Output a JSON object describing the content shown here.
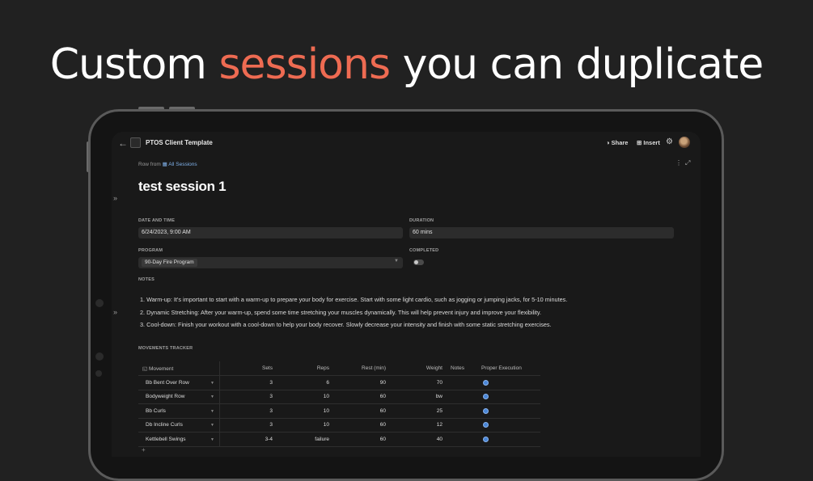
{
  "headline": {
    "before": "Custom",
    "accent": "sessions",
    "after": "you can duplicate"
  },
  "colors": {
    "accent": "#ee6b52",
    "background": "#212121",
    "link": "#7fb0e8"
  },
  "topbar": {
    "back_icon": "back-arrow-icon",
    "title": "PTOS Client Template",
    "share_label": "Share",
    "insert_label": "Insert"
  },
  "row_from": {
    "label": "Row from",
    "link": "All Sessions"
  },
  "session_title": "test session 1",
  "fields": {
    "date_label": "DATE AND TIME",
    "date_value": "6/24/2023, 9:00 AM",
    "duration_label": "DURATION",
    "duration_value": "60 mins",
    "program_label": "PROGRAM",
    "program_value": "90-Day Fire Program",
    "completed_label": "COMPLETED",
    "notes_label": "NOTES"
  },
  "notes": [
    "1.  Warm-up: It's important to start with a warm-up to prepare your body for exercise. Start with some light cardio, such as jogging or jumping jacks, for 5-10 minutes.",
    "2.  Dynamic Stretching: After your warm-up, spend some time stretching your muscles dynamically. This will help prevent injury and improve your flexibility.",
    "3.  Cool-down: Finish your workout with a cool-down to help your body recover. Slowly decrease your intensity and finish with some static stretching exercises."
  ],
  "tracker": {
    "label": "MOVEMENTS TRACKER",
    "columns": [
      "Movement",
      "Sets",
      "Reps",
      "Rest (min)",
      "Weight",
      "Notes",
      "Proper Execution"
    ],
    "rows": [
      {
        "movement": "Bb Bent Over Row",
        "sets": "3",
        "reps": "6",
        "rest": "90",
        "weight": "70",
        "notes": ""
      },
      {
        "movement": "Bodyweight Row",
        "sets": "3",
        "reps": "10",
        "rest": "60",
        "weight": "bw",
        "notes": ""
      },
      {
        "movement": "Bb Curls",
        "sets": "3",
        "reps": "10",
        "rest": "60",
        "weight": "25",
        "notes": ""
      },
      {
        "movement": "Db Incline Curls",
        "sets": "3",
        "reps": "10",
        "rest": "60",
        "weight": "12",
        "notes": ""
      },
      {
        "movement": "Kettlebell Swings",
        "sets": "3-4",
        "reps": "failure",
        "rest": "60",
        "weight": "40",
        "notes": ""
      }
    ],
    "add_label": "+"
  }
}
